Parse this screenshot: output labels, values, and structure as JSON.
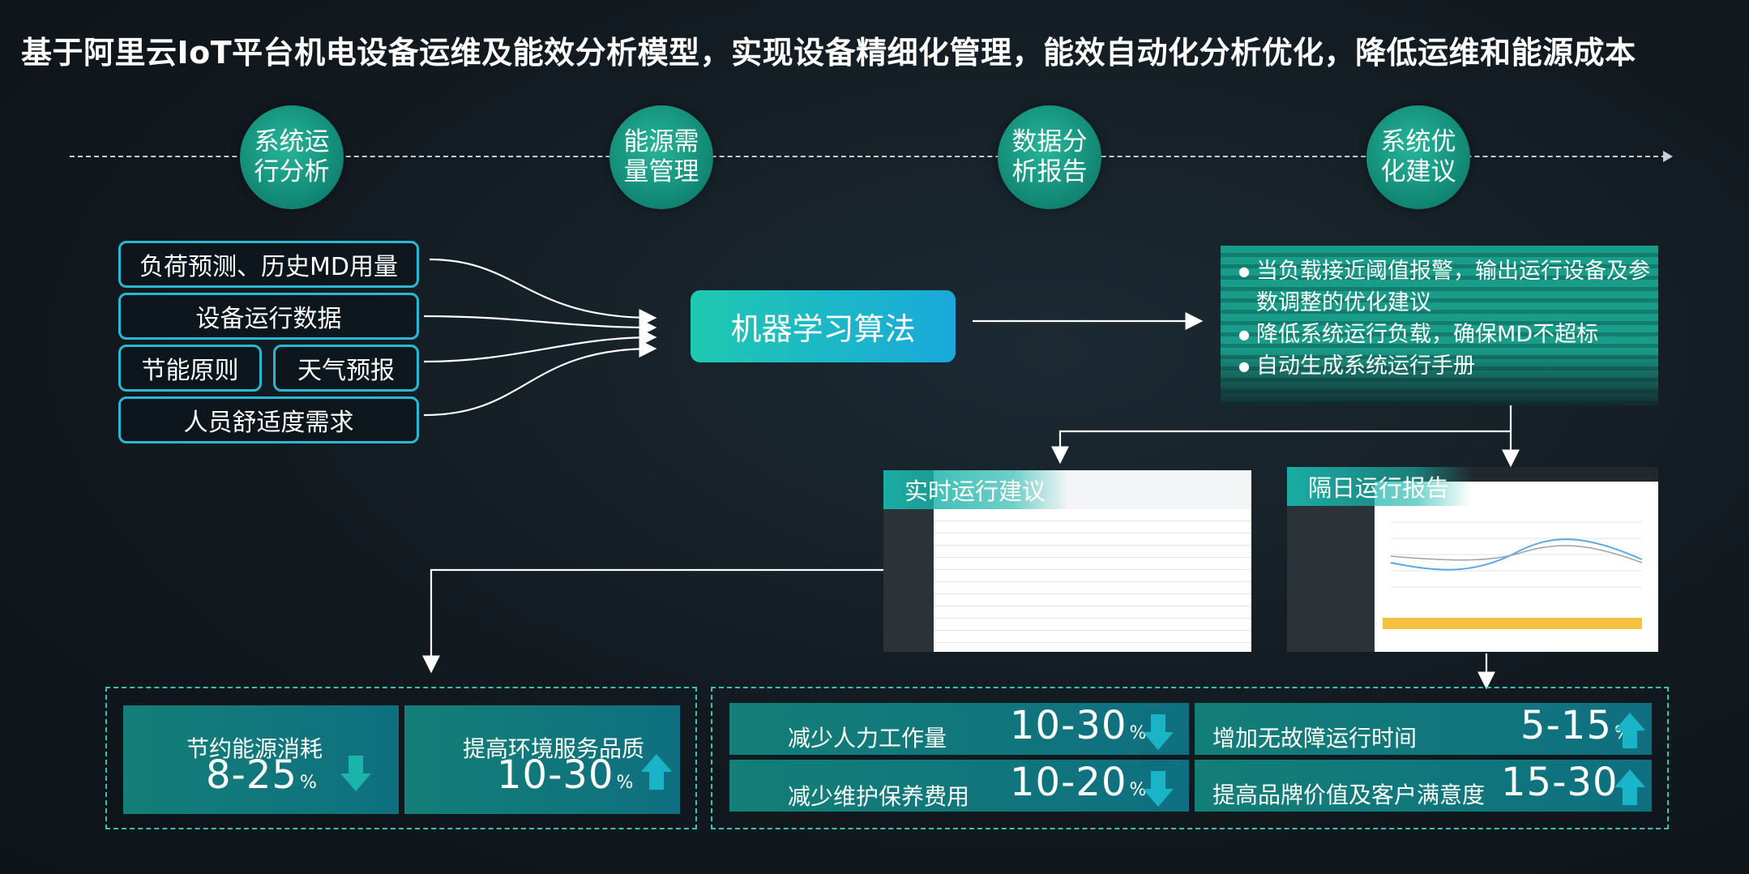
{
  "title": "基于阿里云IoT平台机电设备运维及能效分析模型，实现设备精细化管理，能效自动化分析优化，降低运维和能源成本",
  "stages": [
    "系统运行分析",
    "能源需量管理",
    "数据分析报告",
    "系统优化建议"
  ],
  "inputs": {
    "load_forecast": "负荷预测、历史MD用量",
    "equipment_data": "设备运行数据",
    "energy_principles": "节能原则",
    "weather": "天气预报",
    "comfort": "人员舒适度需求"
  },
  "algorithm": "机器学习算法",
  "suggestions": [
    "当负载接近阈值报警，输出运行设备及参数调整的优化建议",
    "降低系统运行负载，确保MD不超标",
    "自动生成系统运行手册"
  ],
  "screens": {
    "realtime": "实时运行建议",
    "nextday": "隔日运行报告"
  },
  "kpis_left": [
    {
      "label": "节约能源消耗",
      "value": "8-25",
      "unit": "%",
      "direction": "down"
    },
    {
      "label": "提高环境服务品质",
      "value": "10-30",
      "unit": "%",
      "direction": "up"
    }
  ],
  "kpis_right": [
    {
      "label": "减少人力工作量",
      "value": "10-30",
      "unit": "%",
      "direction": "down"
    },
    {
      "label": "增加无故障运行时间",
      "value": "5-15",
      "unit": "%",
      "direction": "up"
    },
    {
      "label": "减少维护保养费用",
      "value": "10-20",
      "unit": "%",
      "direction": "down"
    },
    {
      "label": "提高品牌价值及客户满意度",
      "value": "15-30",
      "unit": "%",
      "direction": "up"
    }
  ],
  "colors": {
    "teal": "#1a9c8a",
    "cyan_border": "#2ab7d3",
    "dash": "#2ec7b4",
    "arrow": "#1ab4c8"
  }
}
